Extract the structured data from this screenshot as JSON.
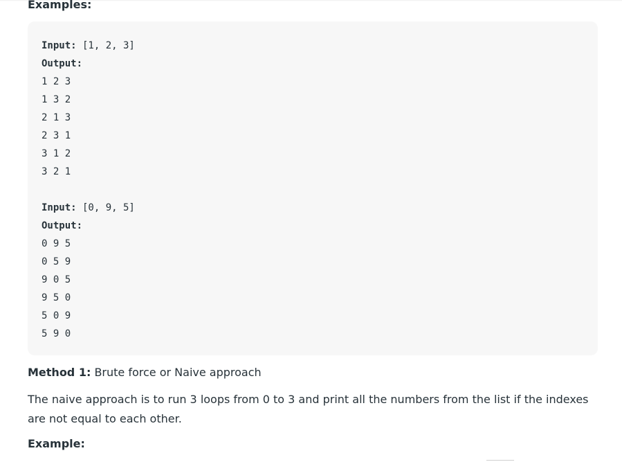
{
  "examples_heading": "Examples:",
  "example1": {
    "input_label": "Input:",
    "input_value": " [1, 2, 3]",
    "output_label": "Output:",
    "output_lines": [
      "1 2 3",
      "1 3 2",
      "2 1 3",
      "2 3 1",
      "3 1 2",
      "3 2 1"
    ]
  },
  "example2": {
    "input_label": "Input:",
    "input_value": " [0, 9, 5]",
    "output_label": "Output:",
    "output_lines": [
      "0 9 5",
      "0 5 9",
      "9 0 5",
      "9 5 0",
      "5 0 9",
      "5 9 0"
    ]
  },
  "method": {
    "label": "Method 1:",
    "text": " Brute force or Naive approach"
  },
  "paragraph": "The naive approach is to run 3 loops from 0 to 3 and print all the numbers from the list if the indexes are not equal to each other.",
  "example_heading": "Example:"
}
